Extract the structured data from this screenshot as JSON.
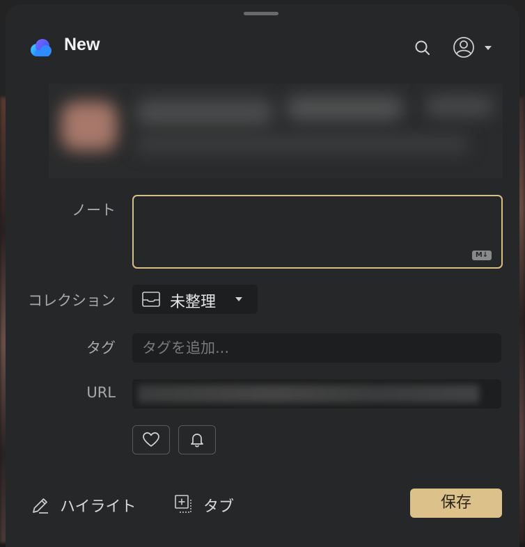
{
  "header": {
    "title": "New",
    "logo_icon": "cloud-logo-icon",
    "search_icon": "search-icon",
    "account_icon": "user-circle-icon"
  },
  "form": {
    "note_label": "ノート",
    "note_value": "",
    "markdown_badge": "M↓",
    "collection_label": "コレクション",
    "collection_value": "未整理",
    "tag_label": "タグ",
    "tag_placeholder": "タグを追加...",
    "url_label": "URL"
  },
  "actions": {
    "highlight_label": "ハイライト",
    "tab_label": "タブ",
    "save_label": "保存"
  },
  "colors": {
    "panel": "#262728",
    "field": "#1d1e1f",
    "accent": "#dcc18a",
    "logo_blue": "#2f8cff"
  }
}
